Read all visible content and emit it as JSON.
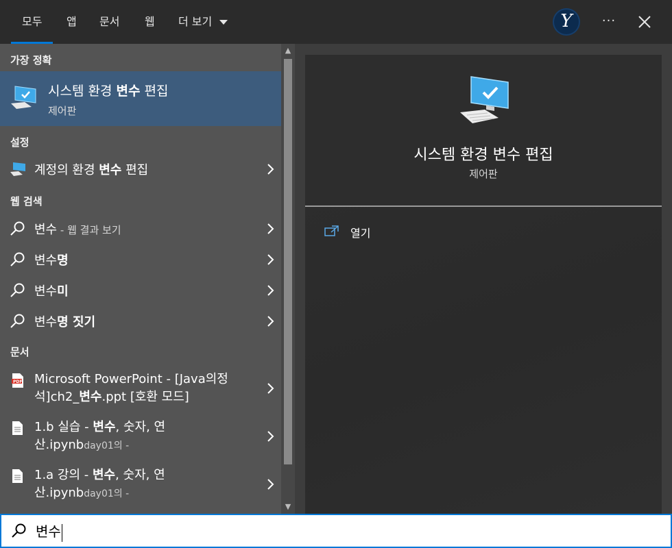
{
  "tabs": [
    "모두",
    "앱",
    "문서",
    "웹",
    "더 보기"
  ],
  "header": {
    "avatar_letter": "Y",
    "more_label": "···"
  },
  "sections": {
    "best_match": "가장 정확",
    "settings": "설정",
    "web": "웹 검색",
    "docs": "문서"
  },
  "best_match": {
    "title_pre": "시스템 환경 ",
    "title_bold": "변수",
    "title_post": " 편집",
    "subtitle": "제어판"
  },
  "settings_item": {
    "pre": "계정의 환경 ",
    "bold": "변수",
    "post": " 편집"
  },
  "web_results": [
    {
      "normal": "변수",
      "bold": "",
      "hint": " - 웹 결과 보기"
    },
    {
      "normal": "변수",
      "bold": "명",
      "hint": ""
    },
    {
      "normal": "변수",
      "bold": "미",
      "hint": ""
    },
    {
      "normal": "변수",
      "bold": "명 짓기",
      "hint": ""
    }
  ],
  "documents": [
    {
      "line1": "Microsoft PowerPoint - [Java의정",
      "line2_pre": "석]ch2_",
      "line2_bold": "변수",
      "line2_post": ".ppt [호환 모드]",
      "icon": "pdf-icon"
    },
    {
      "line1_pre": "1.b 실습 - ",
      "line1_bold": "변수",
      "line1_post": ", 숫자, 연",
      "line2": "산.ipynb",
      "line2_small": "day01의 -",
      "icon": "document-icon"
    },
    {
      "line1_pre": "1.a 강의 - ",
      "line1_bold": "변수",
      "line1_post": ", 숫자, 연",
      "line2": "산.ipynb",
      "line2_small": "day01의 -",
      "icon": "document-icon"
    }
  ],
  "preview": {
    "title": "시스템 환경 변수 편집",
    "subtitle": "제어판",
    "open_label": "열기"
  },
  "search": {
    "value": "변수"
  },
  "colors": {
    "accent": "#0078d7",
    "selected_bg": "#3d5c7d",
    "panel_bg": "#545454",
    "topbar_bg": "#2b2b2b"
  }
}
